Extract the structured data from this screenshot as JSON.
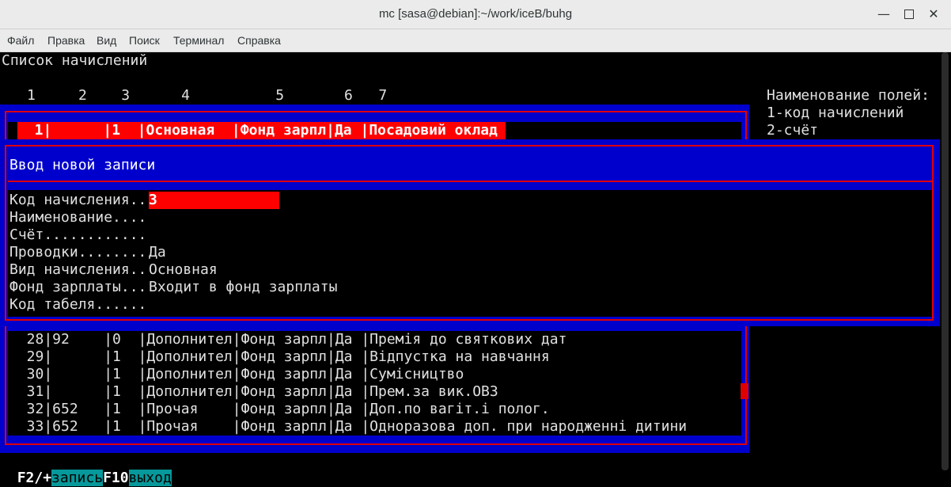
{
  "window": {
    "title": "mc [sasa@debian]:~/work/iceB/buhg"
  },
  "menu": [
    "Файл",
    "Правка",
    "Вид",
    "Поиск",
    "Терминал",
    "Справка"
  ],
  "screen": {
    "heading": "Список начислений",
    "column_numbers": "1     2    3      4          5       6   7",
    "legend_title": "Наименование полей:",
    "legend_items": [
      "1-код начислений",
      "2-счёт"
    ],
    "selected_row": "  1|      |1  |Основная  |Фонд зарпл|Да |Посадовий оклад",
    "rows": [
      "  28|92    |0  |Дополнител|Фонд зарпл|Да |Премія до святкових дат",
      "  29|      |1  |Дополнител|Фонд зарпл|Да |Відпустка на навчання",
      "  30|      |1  |Дополнител|Фонд зарпл|Да |Сумісництво",
      "  31|      |1  |Дополнител|Фонд зарпл|Да |Прем.за вик.ОВЗ",
      "  32|652   |1  |Прочая    |Фонд зарпл|Да |Доп.по вагіт.і полог.",
      "  33|652   |1  |Прочая    |Фонд зарпл|Да |Одноразова доп. при народженні дитини"
    ]
  },
  "dialog": {
    "title": "Ввод новой записи",
    "fields": [
      {
        "label": "Код начисления..",
        "value": "3"
      },
      {
        "label": "Наименование....",
        "value": ""
      },
      {
        "label": "Счёт............",
        "value": ""
      },
      {
        "label": "Проводки........",
        "value": "Да"
      },
      {
        "label": "Вид начисления..",
        "value": "Основная"
      },
      {
        "label": "Фонд зарплаты...",
        "value": "Входит в фонд зарплаты"
      },
      {
        "label": "Код табеля......",
        "value": ""
      }
    ]
  },
  "footer": {
    "key1": "F2/+",
    "label1": "запись",
    "key2": "F10",
    "label2": "выход"
  },
  "colors": {
    "terminal_bg": "#000000",
    "panel_blue": "#0000cc",
    "highlight_red": "#ff0000",
    "frame_red": "#e00000",
    "fkey_label_bg": "#06989a"
  }
}
